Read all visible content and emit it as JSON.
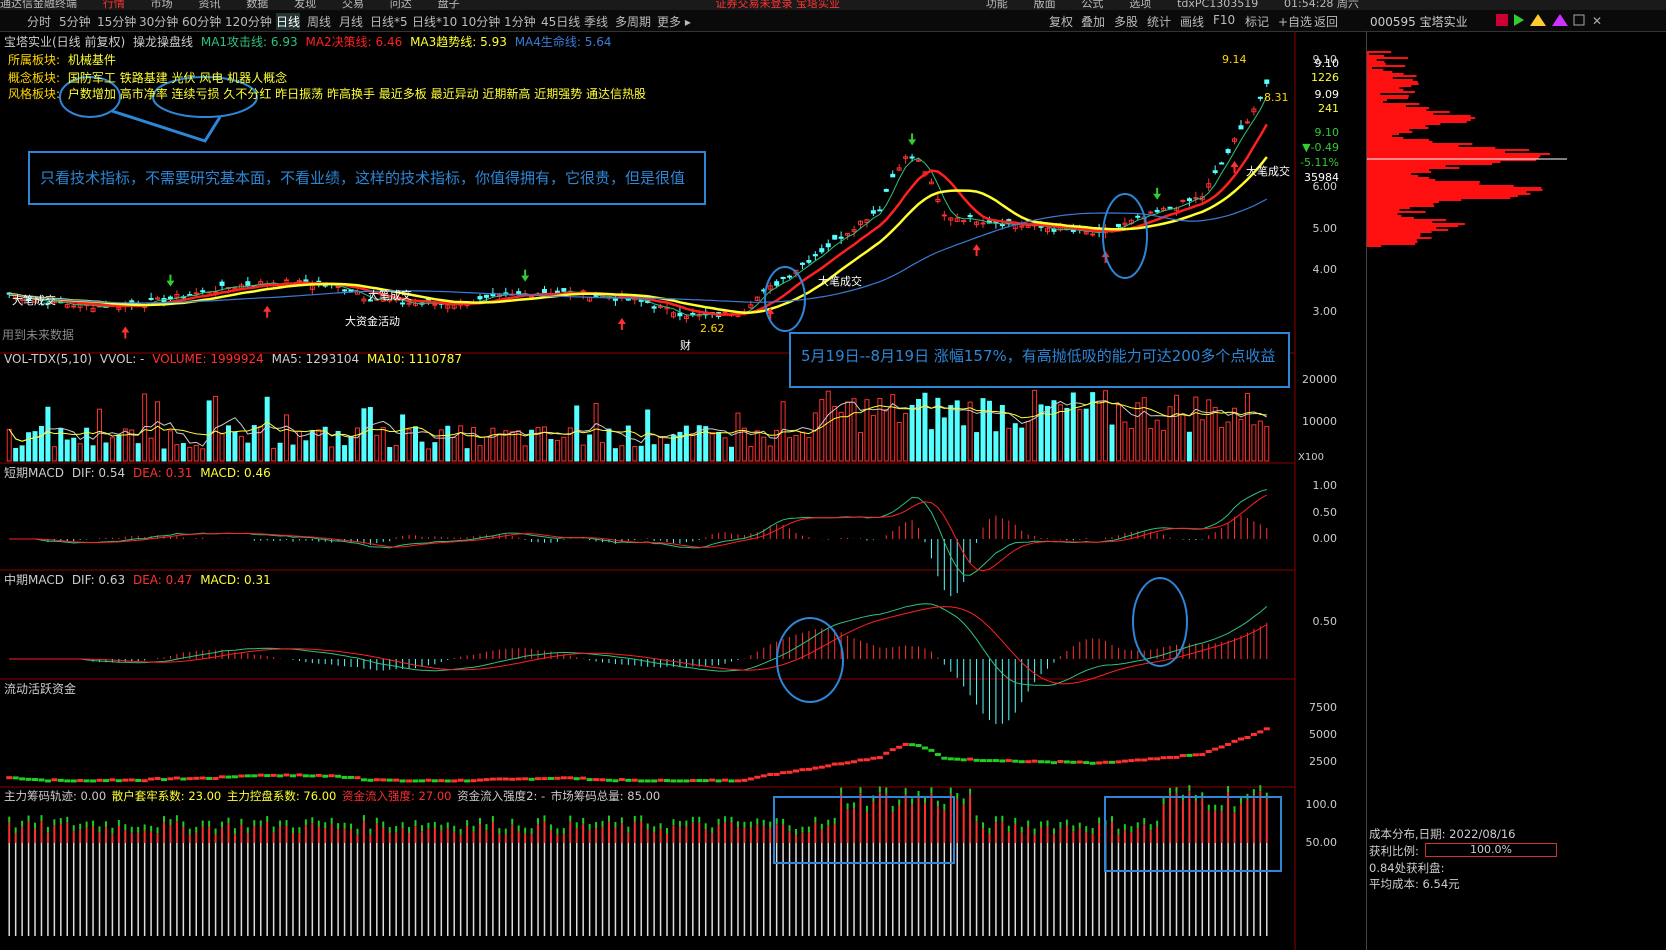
{
  "top_menu": [
    "通达信金融终端",
    "行情",
    "市场",
    "资讯",
    "数据",
    "发现",
    "交易",
    "问达",
    "盘子",
    "证券交易未登录 宝塔实业",
    "功能",
    "版面",
    "公式",
    "选项",
    "tdxPC1303519",
    "01:54:28 周六"
  ],
  "periods": [
    "分时",
    "5分钟",
    "15分钟",
    "30分钟",
    "60分钟",
    "120分钟",
    "日线",
    "周线",
    "月线",
    "日线*5",
    "日线*10",
    "10分钟",
    "1分钟",
    "45日线",
    "季线",
    "多周期",
    "更多 ▸"
  ],
  "active_period": "日线",
  "toolbar": [
    "复权",
    "叠加",
    "多股",
    "统计",
    "画线",
    "F10",
    "标记",
    "+自选",
    "返回"
  ],
  "stock_header": "000595 宝塔实业",
  "main": {
    "title": "宝塔实业(日线 前复权)",
    "indicator": "操龙操盘线",
    "ma1": "MA1攻击线: 6.93",
    "ma2": "MA2决策线: 6.46",
    "ma3": "MA3趋势线: 5.93",
    "ma4": "MA4生命线: 5.64",
    "sector_label": "所属板块:",
    "sector": "机械基件",
    "concept_label": "概念板块:",
    "concept": "国防军工 铁路基建 光伏 风电 机器人概念",
    "style_label": "风格板块:",
    "style": "户数增加 高市净率 连续亏损 久不分红 昨日振荡 昨高换手 最近多板 最近异动 近期新高 近期强势 通达信热股",
    "future_note": "用到未来数据",
    "callout1": "只看技术指标，不需要研究基本面，不看业绩，这样的技术指标，你值得拥有，它很贵，但是很值",
    "callout2": "5月19日--8月19日 涨幅157%，有高抛低吸的能力可达200多个点收益",
    "labels": {
      "big1": "大笔成交",
      "big2": "大笔成交",
      "big3": "大笔成交",
      "big4": "大笔成交",
      "fund": "大资金活动",
      "low": "2.62",
      "high": "9.14",
      "last": "8.31",
      "cai": "财",
      "yu": "预"
    },
    "y_ticks": [
      "9.10",
      "6.00",
      "5.00",
      "4.00",
      "3.00"
    ],
    "price_box": [
      "9.10",
      "1226",
      "9.09",
      "241",
      "9.10",
      "▼-0.49",
      "-5.11%",
      "35984"
    ]
  },
  "vol": {
    "name": "VOL-TDX(5,10)",
    "vvol": "VVOL: -",
    "volume": "VOLUME: 1999924",
    "ma5": "MA5: 1293104",
    "ma10": "MA10: 1110787",
    "ticks": [
      "20000",
      "10000"
    ],
    "unit": "X100"
  },
  "macd1": {
    "name": "短期MACD",
    "dif": "DIF: 0.54",
    "dea": "DEA: 0.31",
    "macd": "MACD: 0.46",
    "ticks": [
      "1.00",
      "0.50",
      "0.00"
    ]
  },
  "macd2": {
    "name": "中期MACD",
    "dif": "DIF: 0.63",
    "dea": "DEA: 0.47",
    "macd": "MACD: 0.31",
    "ticks": [
      "0.50"
    ]
  },
  "flow": {
    "name": "流动活跃资金",
    "ticks": [
      "7500",
      "5000",
      "2500"
    ]
  },
  "chip": {
    "name": "主力筹码轨迹",
    "v0": ": 0.00",
    "v1": "散户套牢系数: 23.00",
    "v2": "主力控盘系数: 76.00",
    "v3": "资金流入强度: 27.00",
    "v4": "资金流入强度2: -",
    "v5": "市场筹码总量: 85.00",
    "ticks": [
      "100.0",
      "50.00"
    ]
  },
  "cost": {
    "title": "成本分布,日期: 2022/08/16",
    "profit_label": "获利比例:",
    "profit": "100.0%",
    "chip_label": "0.84处获利盘:",
    "avg_label": "平均成本: 6.54元"
  },
  "colors": {
    "up": "#ff3030",
    "down": "#54ffff",
    "ma1": "#2ec27e",
    "ma2": "#ff2020",
    "ma3": "#ffff30",
    "ma4": "#3a7bd5",
    "accent": "#2d86d6"
  }
}
